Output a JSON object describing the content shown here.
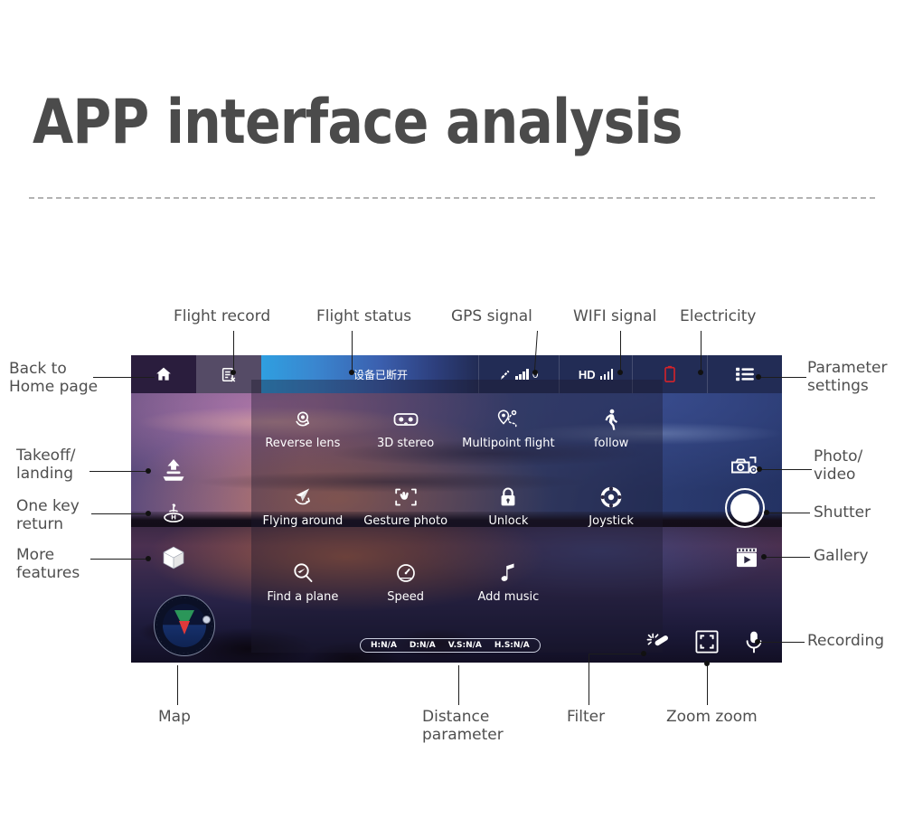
{
  "page": {
    "title": "APP interface analysis"
  },
  "app": {
    "topbar": {
      "home_icon": "home-icon",
      "record_icon": "flight-record-icon",
      "status_text": "设备已断开",
      "gps": {
        "icon": "satellite-icon",
        "value": "0"
      },
      "wifi": {
        "label": "HD",
        "icon": "signal-bars-icon"
      },
      "battery_icon": "battery-icon",
      "settings_icon": "list-menu-icon"
    },
    "menu": {
      "rows": [
        [
          {
            "label": "Reverse lens",
            "icon": "reverse-lens-icon"
          },
          {
            "label": "3D stereo",
            "icon": "vr-goggles-icon"
          },
          {
            "label": "Multipoint flight",
            "icon": "waypoint-pin-icon"
          },
          {
            "label": "follow",
            "icon": "walking-person-icon"
          }
        ],
        [
          {
            "label": "Flying around",
            "icon": "paper-plane-orbit-icon"
          },
          {
            "label": "Gesture photo",
            "icon": "hand-frame-icon"
          },
          {
            "label": "Unlock",
            "icon": "padlock-icon"
          },
          {
            "label": "Joystick",
            "icon": "joystick-ring-icon"
          }
        ],
        [
          {
            "label": "Find a plane",
            "icon": "magnifier-plane-icon"
          },
          {
            "label": "Speed",
            "icon": "speed-gauge-icon"
          },
          {
            "label": "Add music",
            "icon": "music-note-icon"
          }
        ]
      ]
    },
    "left_controls": [
      {
        "name": "takeoff-landing",
        "icon": "takeoff-landing-icon"
      },
      {
        "name": "one-key-return",
        "icon": "return-home-icon"
      },
      {
        "name": "more-features",
        "icon": "cube-icon"
      }
    ],
    "right_controls": [
      {
        "name": "photo-video",
        "icon": "photo-video-toggle-icon"
      },
      {
        "name": "shutter",
        "icon": "shutter-button-icon"
      },
      {
        "name": "gallery",
        "icon": "gallery-film-icon"
      }
    ],
    "bottom_controls": [
      {
        "name": "filter",
        "icon": "magic-wand-icon"
      },
      {
        "name": "zoom",
        "icon": "zoom-frame-icon"
      },
      {
        "name": "recording",
        "icon": "microphone-icon"
      }
    ],
    "map_widget": {
      "name": "compass-radar-map",
      "icon": "compass-icon"
    },
    "distance_parameters": [
      "H:N/A",
      "D:N/A",
      "V.S:N/A",
      "H.S:N/A"
    ]
  },
  "callouts": {
    "flight_record": "Flight record",
    "flight_status": "Flight status",
    "gps_signal": "GPS signal",
    "wifi_signal": "WIFI signal",
    "electricity": "Electricity",
    "back_to_home": "Back to\nHome page",
    "parameter_settings": "Parameter\nsettings",
    "takeoff_landing": "Takeoff/\nlanding",
    "one_key_return": "One key\nreturn",
    "more_features": "More\nfeatures",
    "photo_video": "Photo/\nvideo",
    "shutter": "Shutter",
    "gallery": "Gallery",
    "recording": "Recording",
    "map": "Map",
    "distance_parameter": "Distance\nparameter",
    "filter": "Filter",
    "zoom_zoom": "Zoom zoom"
  },
  "colors": {
    "title": "#4b4b4b",
    "label": "#4f4f4f",
    "leader": "#1d1d1d",
    "status_blue": "#2f9fe0",
    "battery_red": "#d1232a",
    "divider": "#b3b3b3"
  }
}
